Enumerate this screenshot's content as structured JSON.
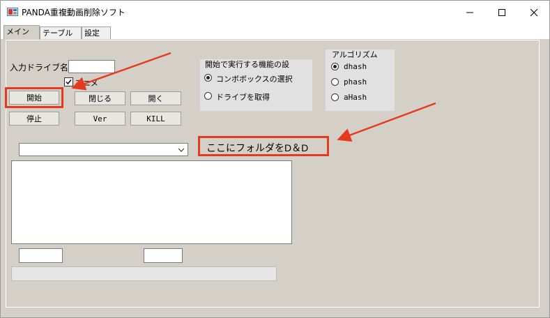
{
  "window": {
    "title": "PANDA重複動画削除ソフト"
  },
  "tabs": [
    {
      "label": "メイン"
    },
    {
      "label": "テーブル"
    },
    {
      "label": "設定"
    }
  ],
  "main": {
    "drive_label": "入力ドライブ名:",
    "drive_value": "",
    "anime_checkbox_label": "アニメ",
    "anime_checked": true,
    "buttons": {
      "start": "開始",
      "close": "閉じる",
      "open": "開く",
      "stop": "停止",
      "ver": "Ver",
      "kill": "KILL"
    },
    "function_group": {
      "title": "開始で実行する機能の設",
      "options": [
        "コンボボックスの選択",
        "ドライブを取得"
      ],
      "selected": 0
    },
    "algorithm_group": {
      "title": "アルゴリズム",
      "options": [
        "dhash",
        "phash",
        "aHash"
      ],
      "selected": 0
    },
    "combo_value": "",
    "dd_hint": "ここにフォルダをD＆D",
    "field1": "",
    "field2": ""
  },
  "colors": {
    "annotation": "#e53a1e",
    "background": "#d4d0c8"
  }
}
